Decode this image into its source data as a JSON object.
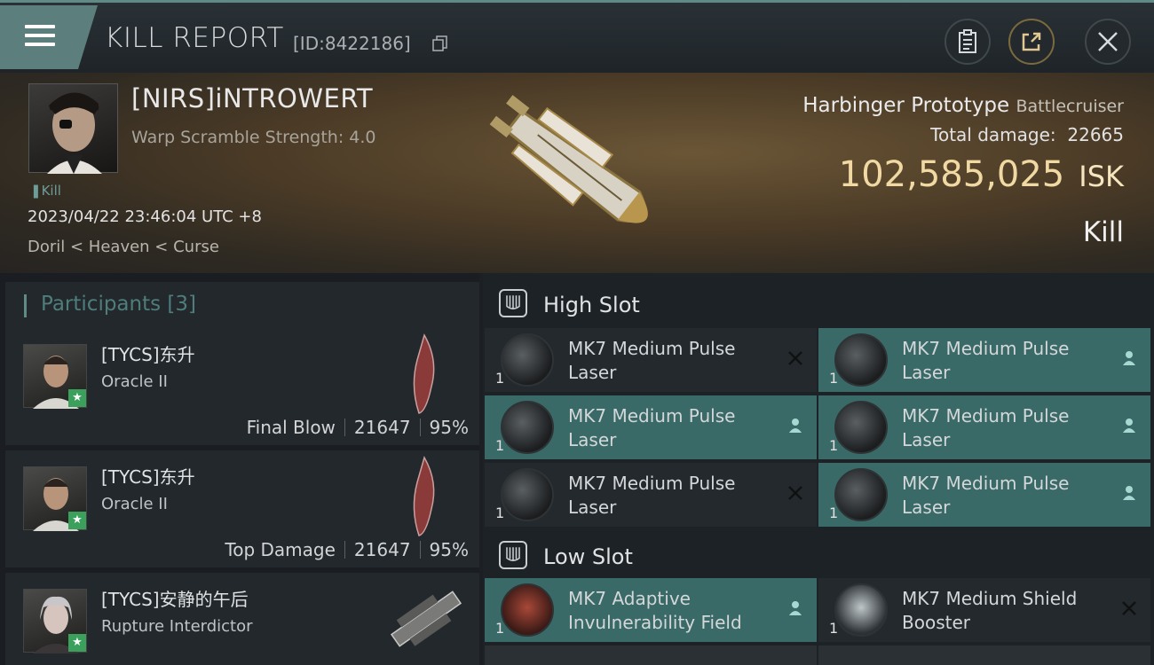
{
  "header": {
    "title": "KILL REPORT",
    "report_id": "[ID:8422186]",
    "icons": [
      "menu-icon",
      "copy-icon",
      "clipboard-icon",
      "share-icon",
      "close-icon"
    ]
  },
  "victim": {
    "name": "[NIRS]iNTROWERT",
    "warp_scramble": "Warp Scramble Strength: 4.0",
    "tag": "Kill",
    "datetime": "2023/04/22 23:46:04 UTC +8",
    "location": "Doril < Heaven < Curse",
    "ship_name": "Harbinger Prototype",
    "ship_class": "Battlecruiser",
    "total_damage_label": "Total damage:",
    "total_damage_value": "22665",
    "isk_value": "102,585,025",
    "isk_unit": "ISK",
    "result": "Kill"
  },
  "participants": {
    "title": "Participants [3]",
    "rows": [
      {
        "name": "[TYCS]东升",
        "ship": "Oracle II",
        "role": "Final Blow",
        "damage": "21647",
        "percent": "95%"
      },
      {
        "name": "[TYCS]东升",
        "ship": "Oracle II",
        "role": "Top Damage",
        "damage": "21647",
        "percent": "95%"
      },
      {
        "name": "[TYCS]安静的午后",
        "ship": "Rupture Interdictor",
        "role": "",
        "damage": "",
        "percent": ""
      }
    ]
  },
  "slots": {
    "high": {
      "title": "High Slot",
      "modules": [
        {
          "qty": "1",
          "name": "MK7 Medium Pulse Laser",
          "status": "destroyed",
          "active": false
        },
        {
          "qty": "1",
          "name": "MK7 Medium Pulse Laser",
          "status": "dropped",
          "active": true
        },
        {
          "qty": "1",
          "name": "MK7 Medium Pulse Laser",
          "status": "dropped",
          "active": true
        },
        {
          "qty": "1",
          "name": "MK7 Medium Pulse Laser",
          "status": "dropped",
          "active": true
        },
        {
          "qty": "1",
          "name": "MK7 Medium Pulse Laser",
          "status": "destroyed",
          "active": false
        },
        {
          "qty": "1",
          "name": "MK7 Medium Pulse Laser",
          "status": "dropped",
          "active": true
        }
      ]
    },
    "low": {
      "title": "Low Slot",
      "modules": [
        {
          "qty": "1",
          "name": "MK7 Adaptive Invulnerability Field",
          "status": "dropped",
          "active": true
        },
        {
          "qty": "1",
          "name": "MK7 Medium Shield Booster",
          "status": "destroyed",
          "active": false
        }
      ]
    }
  }
}
